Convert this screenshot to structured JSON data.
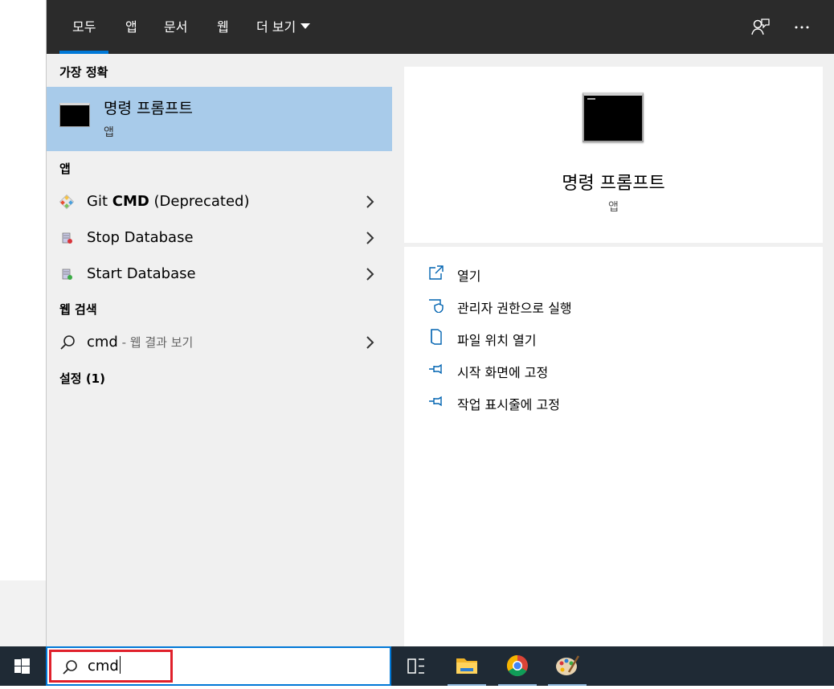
{
  "tabs": [
    {
      "label": "모두",
      "active": true
    },
    {
      "label": "앱"
    },
    {
      "label": "문서"
    },
    {
      "label": "웹"
    },
    {
      "label": "더 보기"
    }
  ],
  "top_icons": [
    "feedback-icon",
    "more-options-icon"
  ],
  "sections": {
    "best_match": "가장 정확",
    "apps": "앱",
    "web": "웹 검색",
    "settings": "설정 (1)"
  },
  "best_match": {
    "title": "명령 프롬프트",
    "subtitle": "앱"
  },
  "apps": [
    {
      "pre": "Git ",
      "bold": "CMD",
      "post": " (Deprecated)",
      "icon": "git-icon"
    },
    {
      "pre": "Stop Database",
      "bold": "",
      "post": "",
      "icon": "database-stop-icon"
    },
    {
      "pre": "Start Database",
      "bold": "",
      "post": "",
      "icon": "database-start-icon"
    }
  ],
  "web": {
    "query": "cmd",
    "suffix": " - 웹 결과 보기"
  },
  "preview": {
    "title": "명령 프롬프트",
    "subtitle": "앱"
  },
  "actions": [
    {
      "label": "열기",
      "icon": "open-icon"
    },
    {
      "label": "관리자 권한으로 실행",
      "icon": "shield-icon"
    },
    {
      "label": "파일 위치 열기",
      "icon": "file-location-icon"
    },
    {
      "label": "시작 화면에 고정",
      "icon": "pin-icon"
    },
    {
      "label": "작업 표시줄에 고정",
      "icon": "pin-icon"
    }
  ],
  "taskbar": {
    "search_value": "cmd",
    "icons": [
      "task-view-icon",
      "file-explorer-icon",
      "chrome-icon",
      "paint-icon"
    ]
  }
}
